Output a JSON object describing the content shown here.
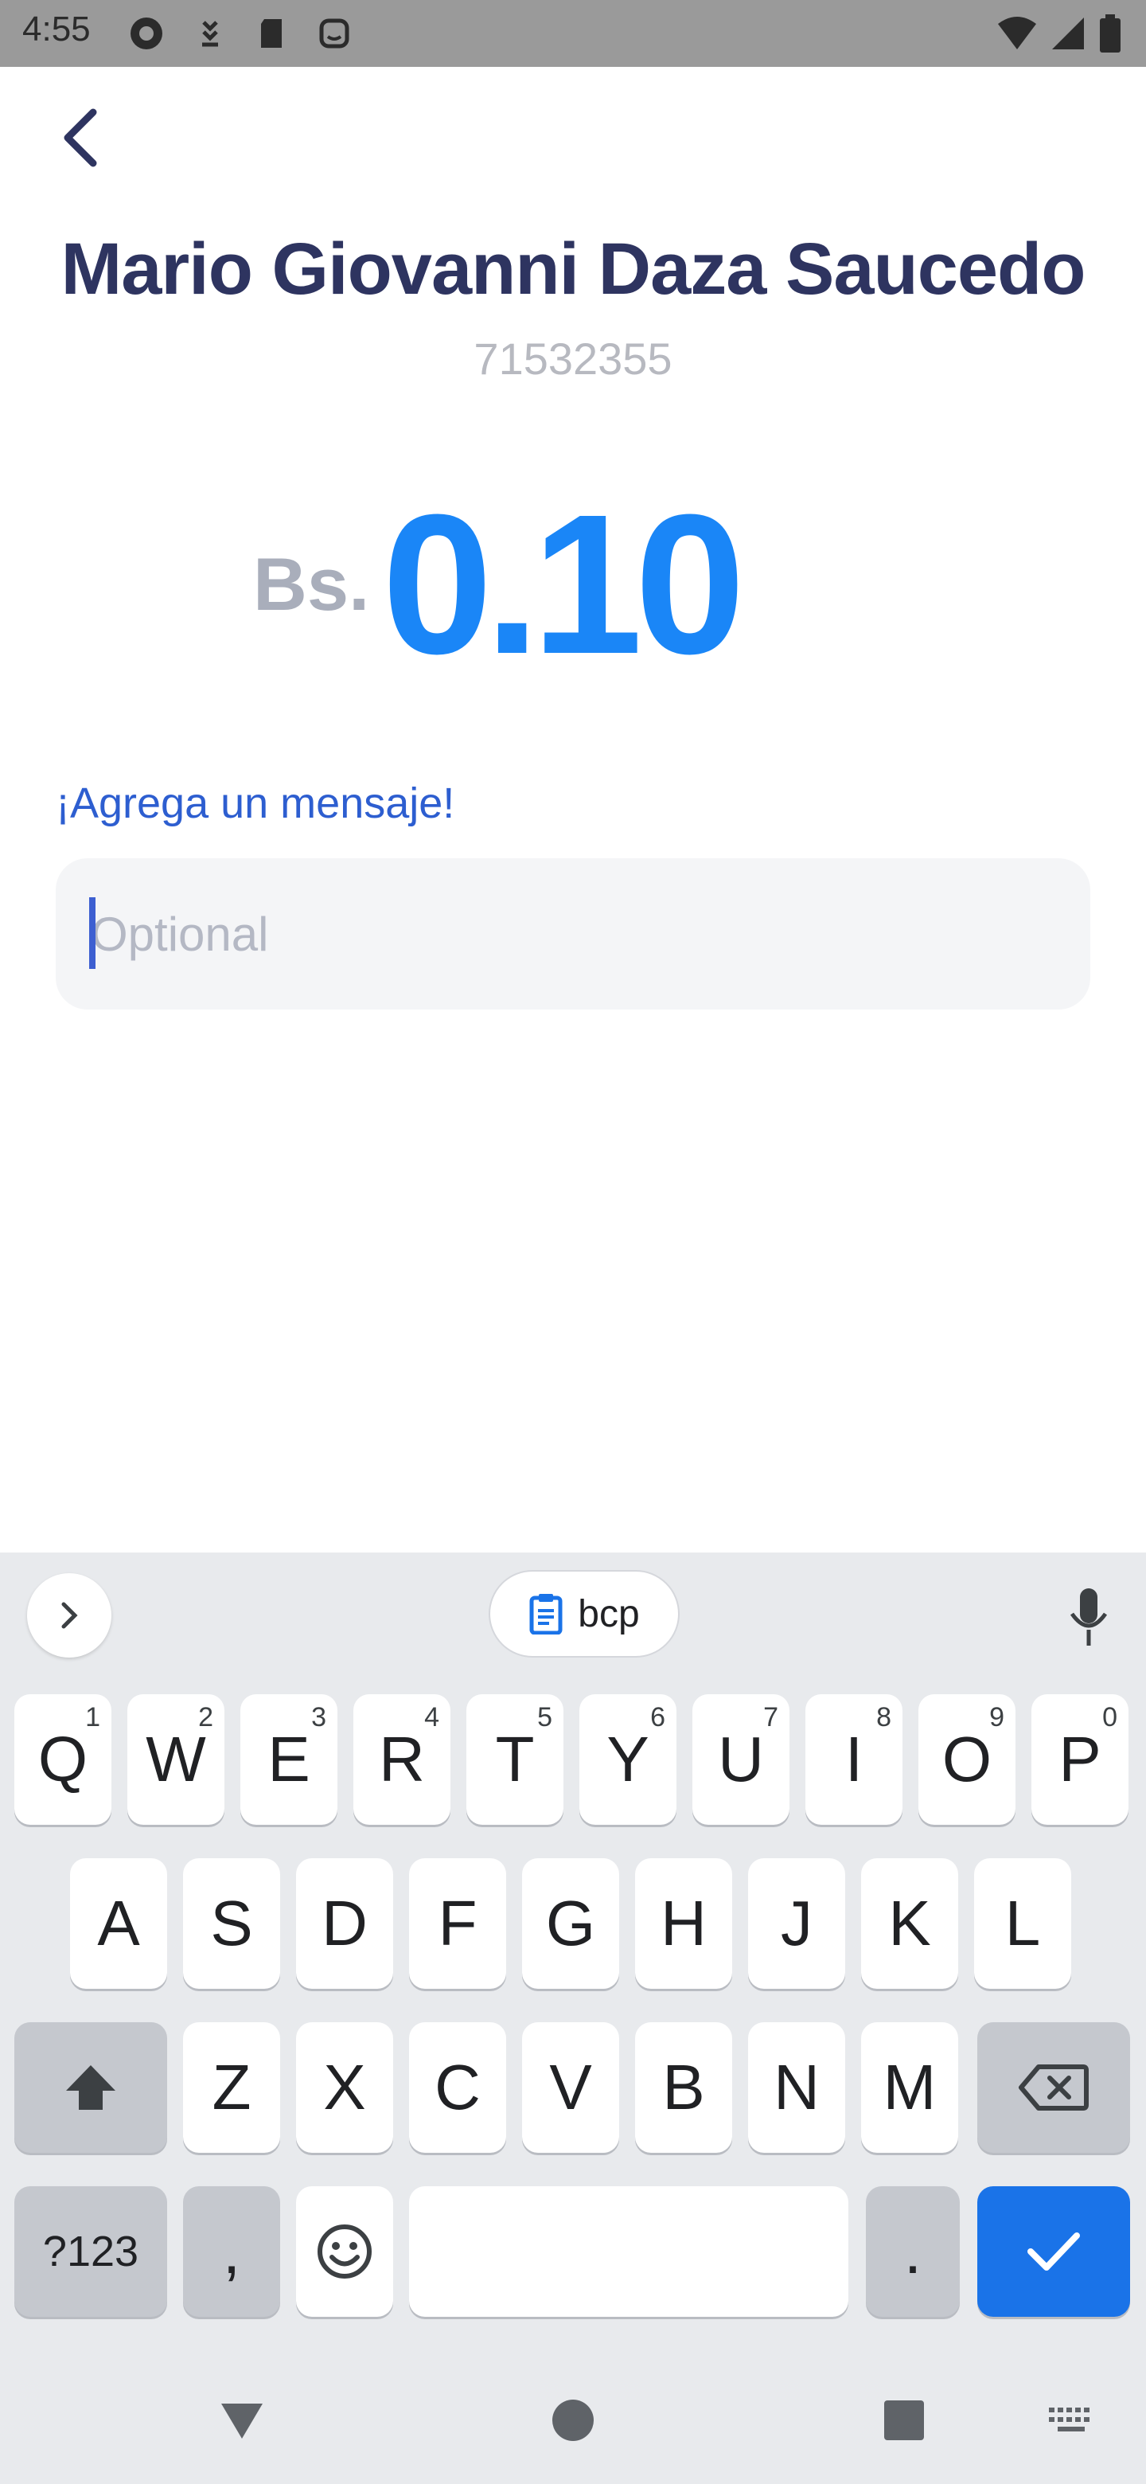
{
  "status_bar": {
    "time": "4:55",
    "left_icons": [
      "app-notification-icon",
      "download-icon",
      "sd-card-icon",
      "assistant-icon"
    ],
    "right_icons": [
      "wifi-icon",
      "signal-icon",
      "battery-icon"
    ]
  },
  "header": {
    "back_icon": "chevron-left-icon"
  },
  "recipient": {
    "name": "Mario Giovanni Daza Saucedo",
    "phone": "71532355"
  },
  "amount": {
    "currency": "Bs.",
    "value": "0.10"
  },
  "message": {
    "label": "¡Agrega un mensaje!",
    "placeholder": "Optional",
    "value": ""
  },
  "keyboard": {
    "clipboard_suggestion": "bcp",
    "row1": [
      {
        "label": "Q",
        "hint": "1"
      },
      {
        "label": "W",
        "hint": "2"
      },
      {
        "label": "E",
        "hint": "3"
      },
      {
        "label": "R",
        "hint": "4"
      },
      {
        "label": "T",
        "hint": "5"
      },
      {
        "label": "Y",
        "hint": "6"
      },
      {
        "label": "U",
        "hint": "7"
      },
      {
        "label": "I",
        "hint": "8"
      },
      {
        "label": "O",
        "hint": "9"
      },
      {
        "label": "P",
        "hint": "0"
      }
    ],
    "row2": [
      "A",
      "S",
      "D",
      "F",
      "G",
      "H",
      "J",
      "K",
      "L"
    ],
    "row3": [
      "Z",
      "X",
      "C",
      "V",
      "B",
      "N",
      "M"
    ],
    "symbols_label": "?123",
    "comma_label": ",",
    "period_label": "."
  },
  "colors": {
    "accent": "#1a86f7",
    "name": "#2e3460",
    "label": "#2d5ed0",
    "keyboard_enter": "#1a73e8"
  }
}
